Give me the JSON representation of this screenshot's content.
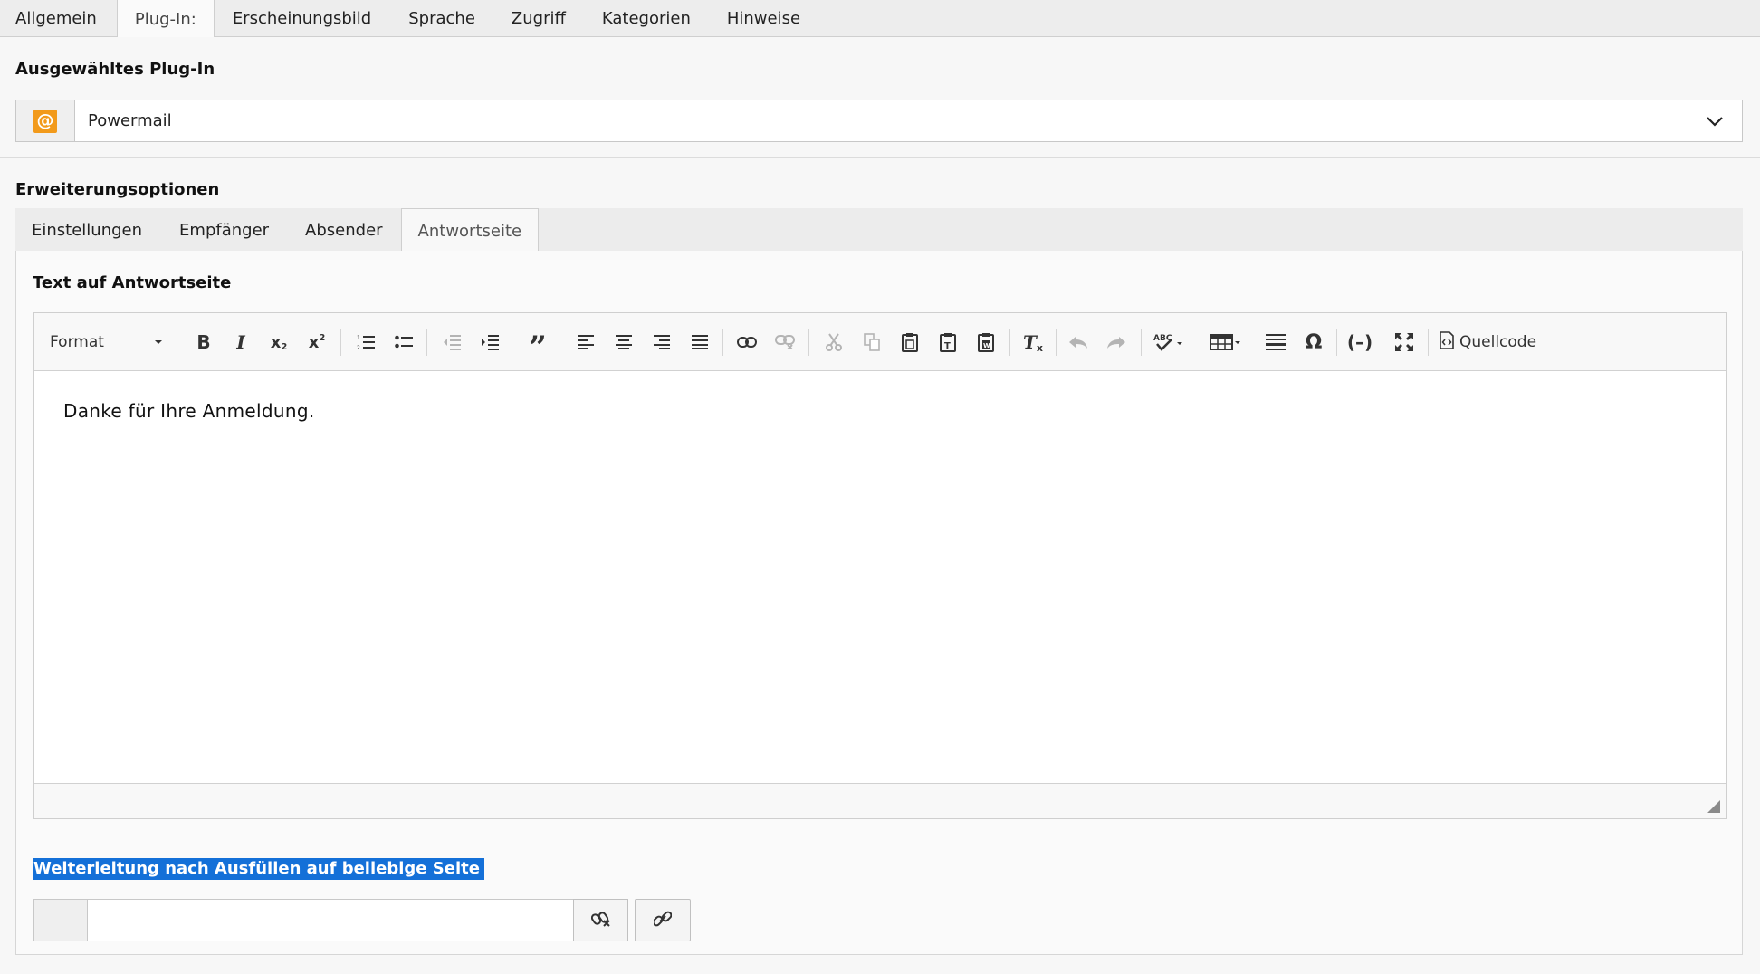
{
  "top_tabs": [
    {
      "label": "Allgemein",
      "active": false
    },
    {
      "label": "Plug-In:",
      "active": true
    },
    {
      "label": "Erscheinungsbild",
      "active": false
    },
    {
      "label": "Sprache",
      "active": false
    },
    {
      "label": "Zugriff",
      "active": false
    },
    {
      "label": "Kategorien",
      "active": false
    },
    {
      "label": "Hinweise",
      "active": false
    }
  ],
  "plugin": {
    "heading": "Ausgewähltes Plug-In",
    "selected": "Powermail",
    "icon": "powermail-at-icon",
    "icon_glyph": "@",
    "icon_color": "#f29a1b"
  },
  "extension": {
    "heading": "Erweiterungsoptionen",
    "tabs": [
      {
        "label": "Einstellungen",
        "active": false
      },
      {
        "label": "Empfänger",
        "active": false
      },
      {
        "label": "Absender",
        "active": false
      },
      {
        "label": "Antwortseite",
        "active": true
      }
    ]
  },
  "editor": {
    "label": "Text auf Antwortseite",
    "format_label": "Format",
    "source_label": "Quellcode",
    "content": "Danke für Ihre Anmeldung.",
    "toolbar": [
      {
        "name": "bold-icon",
        "enabled": true
      },
      {
        "name": "italic-icon",
        "enabled": true
      },
      {
        "name": "subscript-icon",
        "enabled": true
      },
      {
        "name": "superscript-icon",
        "enabled": true
      },
      {
        "name": "numbered-list-icon",
        "enabled": true
      },
      {
        "name": "bulleted-list-icon",
        "enabled": true
      },
      {
        "name": "decrease-indent-icon",
        "enabled": false
      },
      {
        "name": "increase-indent-icon",
        "enabled": true
      },
      {
        "name": "blockquote-icon",
        "enabled": true
      },
      {
        "name": "align-left-icon",
        "enabled": true
      },
      {
        "name": "align-center-icon",
        "enabled": true
      },
      {
        "name": "align-right-icon",
        "enabled": true
      },
      {
        "name": "justify-icon",
        "enabled": true
      },
      {
        "name": "link-icon",
        "enabled": true
      },
      {
        "name": "unlink-icon",
        "enabled": false
      },
      {
        "name": "cut-icon",
        "enabled": false
      },
      {
        "name": "copy-icon",
        "enabled": false
      },
      {
        "name": "paste-icon",
        "enabled": true
      },
      {
        "name": "paste-text-icon",
        "enabled": true
      },
      {
        "name": "paste-word-icon",
        "enabled": true
      },
      {
        "name": "remove-format-icon",
        "enabled": true
      },
      {
        "name": "undo-icon",
        "enabled": false
      },
      {
        "name": "redo-icon",
        "enabled": false
      },
      {
        "name": "spellcheck-icon",
        "enabled": true
      },
      {
        "name": "table-icon",
        "enabled": true
      },
      {
        "name": "horizontal-line-icon",
        "enabled": true
      },
      {
        "name": "special-char-icon",
        "enabled": true
      },
      {
        "name": "soft-hyphen-icon",
        "enabled": true
      },
      {
        "name": "maximize-icon",
        "enabled": true
      },
      {
        "name": "source-icon",
        "enabled": true
      }
    ]
  },
  "redirect": {
    "label": "Weiterleitung nach Ausfüllen auf beliebige Seite",
    "value": "",
    "highlight_color": "#1470d8"
  }
}
